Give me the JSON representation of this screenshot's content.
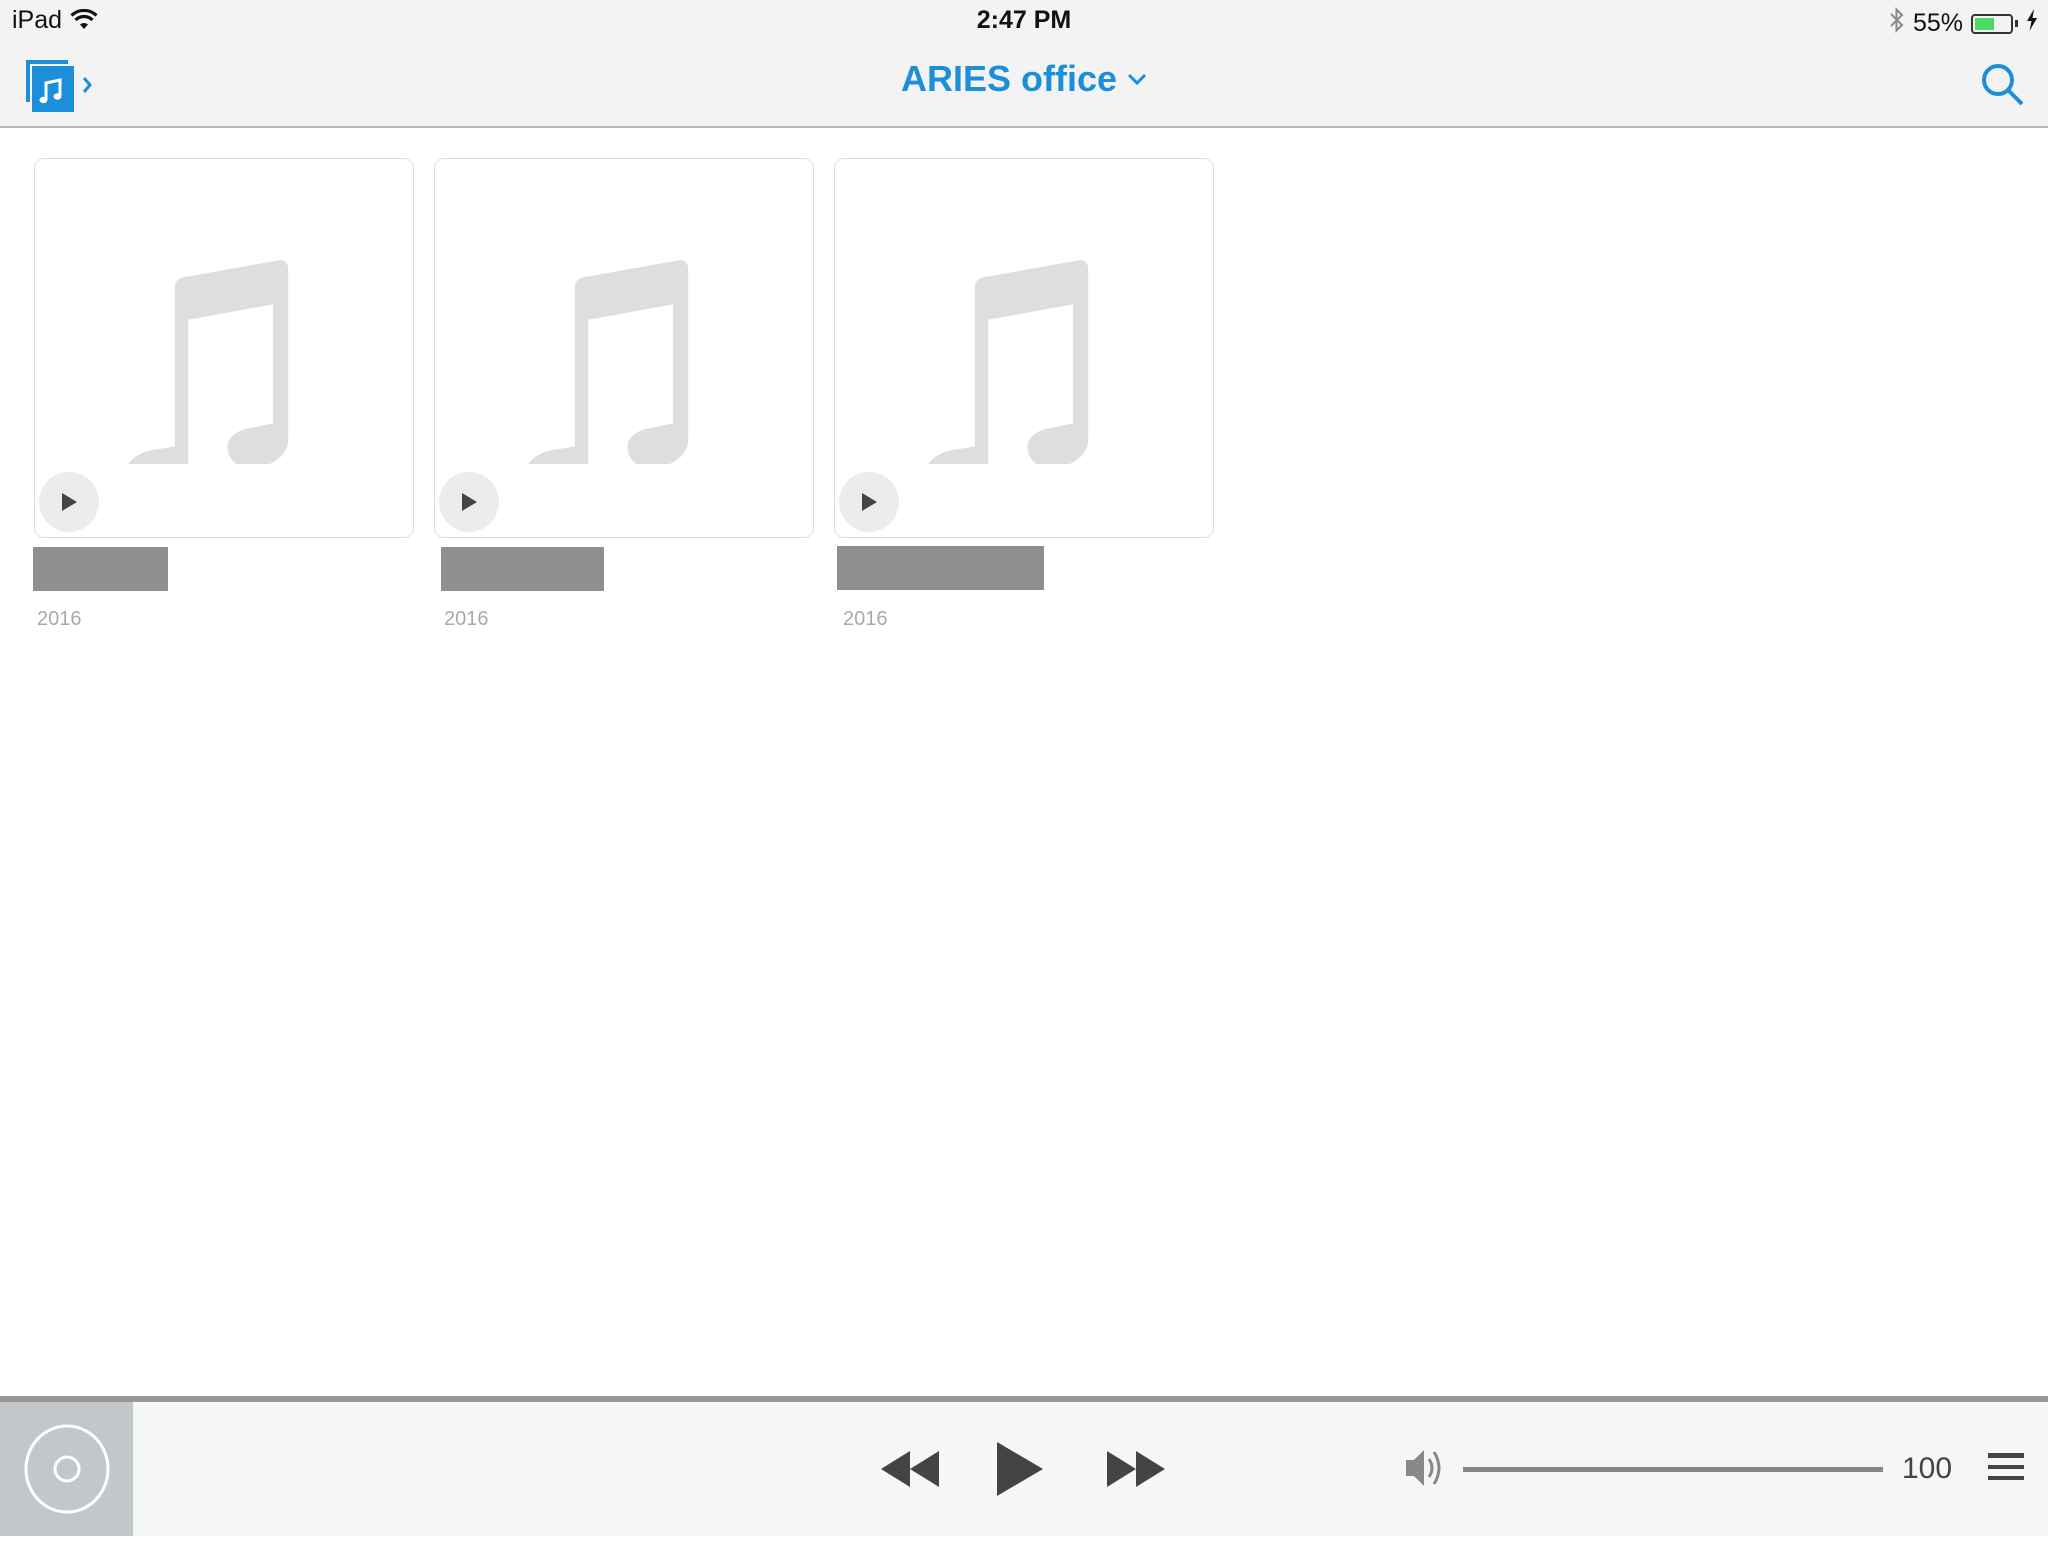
{
  "status_bar": {
    "carrier": "iPad",
    "time": "2:47 PM",
    "battery_percent_label": "55%",
    "battery_level": 0.55,
    "icons": [
      "wifi-icon",
      "bluetooth-icon",
      "battery-icon",
      "charging-bolt-icon"
    ]
  },
  "nav": {
    "library_icon": "music-library-icon",
    "title": "ARIES office",
    "title_icon": "chevron-down-icon",
    "search_icon": "search-icon"
  },
  "albums": [
    {
      "title": "",
      "year": "2016",
      "art_icon": "music-note-icon",
      "play_icon": "play-icon"
    },
    {
      "title": "",
      "year": "2016",
      "art_icon": "music-note-icon",
      "play_icon": "play-icon"
    },
    {
      "title": "",
      "year": "2016",
      "art_icon": "music-note-icon",
      "play_icon": "play-icon"
    }
  ],
  "player": {
    "zone_icon": "speaker-zone-icon",
    "controls": [
      "rewind-icon",
      "play-icon",
      "fast-forward-icon"
    ],
    "volume_icon": "volume-icon",
    "volume": 100,
    "volume_label": "100",
    "queue_icon": "queue-list-icon"
  },
  "colors": {
    "accent": "#1d8ed9",
    "battery_green": "#4cd964",
    "redaction_gray": "#8f8f8f"
  }
}
